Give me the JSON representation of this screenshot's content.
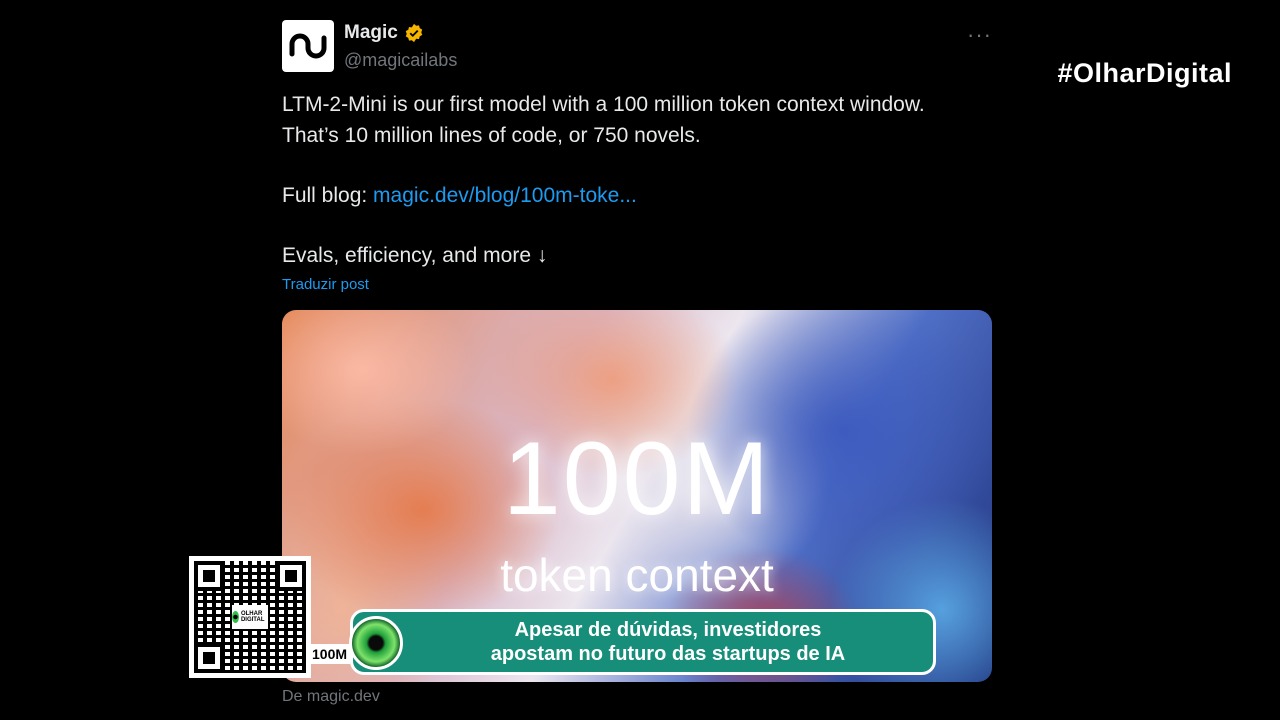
{
  "tweet": {
    "display_name": "Magic",
    "handle": "@magicailabs",
    "more": "···",
    "line1": "LTM-2-Mini is our first model with a 100 million token context window.",
    "line2": "That’s 10 million lines of code, or 750 novels.",
    "blog_label": "Full blog: ",
    "blog_link": "magic.dev/blog/100m-toke...",
    "evals": "Evals, efficiency, and more ↓",
    "translate": "Traduzir post",
    "media_big": "100M",
    "media_small": "token context",
    "source": "De magic.dev"
  },
  "overlay": {
    "hashtag": "#OlharDigital",
    "headline_line1": "Apesar de dúvidas, investidores",
    "headline_line2": "apostam no futuro das startups de IA",
    "label_100m": "100M",
    "qr_logo": "OLHAR DIGITAL"
  },
  "colors": {
    "background": "#000000",
    "link": "#1d9bf0",
    "banner": "#178e7a",
    "verified": "#f4b400"
  },
  "icons": [
    "magic-logo-icon",
    "verified-badge-icon",
    "more-options-icon",
    "eye-logo-icon",
    "qr-code-icon"
  ]
}
